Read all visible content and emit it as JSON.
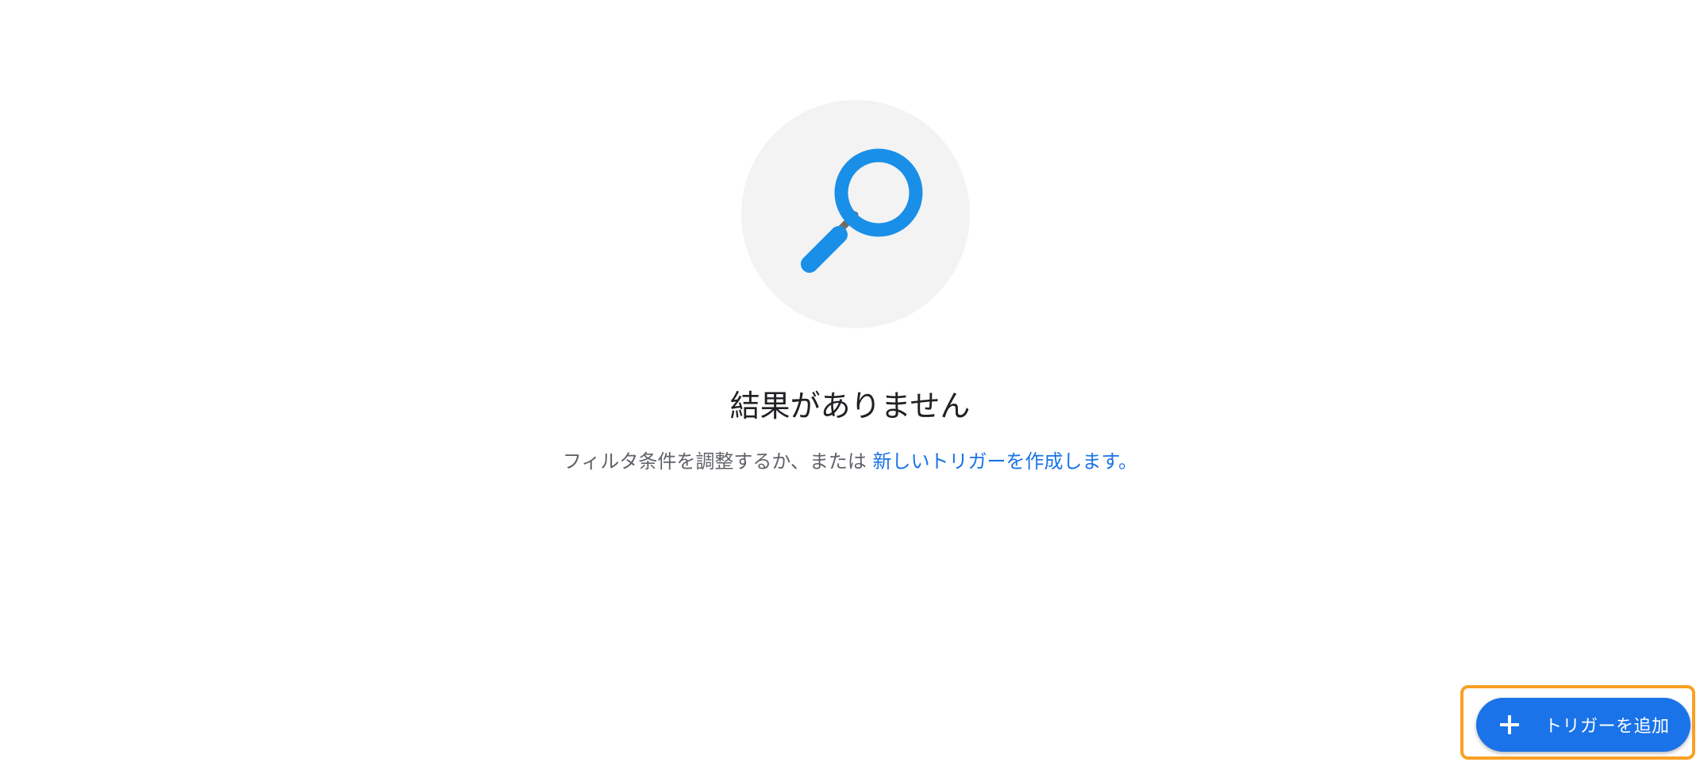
{
  "empty_state": {
    "title": "結果がありません",
    "description_prefix": "フィルタ条件を調整するか、または",
    "create_link": "新しいトリガーを作成します",
    "description_suffix": "。"
  },
  "fab": {
    "icon": "plus-icon",
    "label": "トリガーを追加"
  },
  "colors": {
    "accent": "#1a73e8",
    "magnifier": "#1a8fe8",
    "handle_joint": "#6d6d6d",
    "illustration_bg": "#f3f3f3",
    "highlight": "#f9a023"
  }
}
